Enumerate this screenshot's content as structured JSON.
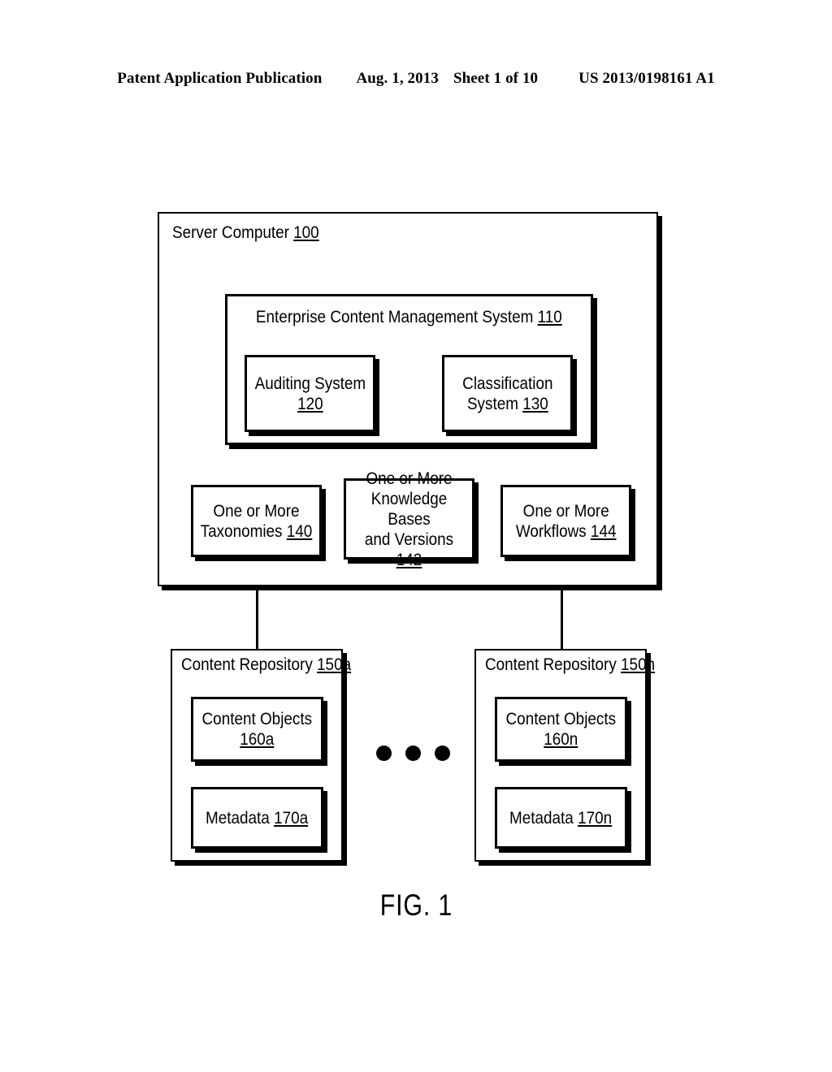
{
  "header": {
    "publication": "Patent Application Publication",
    "date": "Aug. 1, 2013",
    "sheet": "Sheet 1 of 10",
    "doc_number": "US 2013/0198161 A1"
  },
  "figure": {
    "caption": "FIG. 1"
  },
  "diagram": {
    "server": {
      "title_text": "Server Computer ",
      "title_ref": "100"
    },
    "ecm": {
      "title_text": "Enterprise Content Management System ",
      "title_ref": "110"
    },
    "auditing": {
      "line1": "Auditing System",
      "ref": "120"
    },
    "classification": {
      "line1": "Classification",
      "line2": "System ",
      "ref": "130"
    },
    "taxonomies": {
      "line1": "One or More",
      "line2": "Taxonomies ",
      "ref": "140"
    },
    "knowledge_bases": {
      "line1": "One or More",
      "line2": "Knowledge Bases",
      "line3": "and Versions ",
      "ref": "142"
    },
    "workflows": {
      "line1": "One or More",
      "line2": "Workflows ",
      "ref": "144"
    },
    "repository_a": {
      "title_text": "Content Repository ",
      "title_ref": "150a",
      "content_objects": {
        "line1": "Content Objects",
        "ref": "160a"
      },
      "metadata": {
        "line1": "Metadata ",
        "ref": "170a"
      }
    },
    "repository_n": {
      "title_text": "Content Repository ",
      "title_ref": "150n",
      "content_objects": {
        "line1": "Content Objects",
        "ref": "160n"
      },
      "metadata": {
        "line1": "Metadata ",
        "ref": "170n"
      }
    },
    "ellipsis": {
      "dot_count": 3
    }
  }
}
